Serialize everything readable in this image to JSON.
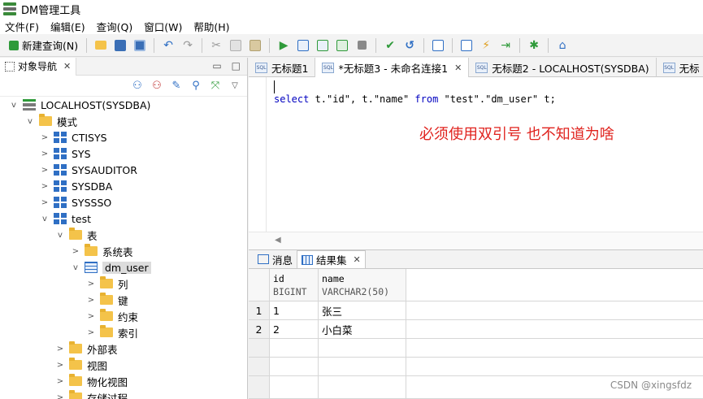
{
  "window": {
    "title": "DM管理工具"
  },
  "menu": [
    "文件(F)",
    "编辑(E)",
    "查询(Q)",
    "窗口(W)",
    "帮助(H)"
  ],
  "toolbar": {
    "new_query_label": "新建查询(N)"
  },
  "navigator": {
    "tab_label": "对象导航",
    "tree": [
      {
        "label": "LOCALHOST(SYSDBA)",
        "icon": "server",
        "twisty": "expanded",
        "level": 0
      },
      {
        "label": "模式",
        "icon": "folder",
        "twisty": "expanded",
        "level": 1
      },
      {
        "label": "CTISYS",
        "icon": "schema",
        "twisty": "collapsed",
        "level": 2
      },
      {
        "label": "SYS",
        "icon": "schema",
        "twisty": "collapsed",
        "level": 2
      },
      {
        "label": "SYSAUDITOR",
        "icon": "schema",
        "twisty": "collapsed",
        "level": 2
      },
      {
        "label": "SYSDBA",
        "icon": "schema",
        "twisty": "collapsed",
        "level": 2
      },
      {
        "label": "SYSSSO",
        "icon": "schema",
        "twisty": "collapsed",
        "level": 2
      },
      {
        "label": "test",
        "icon": "schema",
        "twisty": "expanded",
        "level": 2
      },
      {
        "label": "表",
        "icon": "folder",
        "twisty": "expanded",
        "level": 3
      },
      {
        "label": "系统表",
        "icon": "folder",
        "twisty": "collapsed",
        "level": 4
      },
      {
        "label": "dm_user",
        "icon": "table",
        "twisty": "expanded",
        "level": 4,
        "selected": true
      },
      {
        "label": "列",
        "icon": "folder",
        "twisty": "collapsed",
        "level": 5
      },
      {
        "label": "键",
        "icon": "folder",
        "twisty": "collapsed",
        "level": 5
      },
      {
        "label": "约束",
        "icon": "folder",
        "twisty": "collapsed",
        "level": 5
      },
      {
        "label": "索引",
        "icon": "folder",
        "twisty": "collapsed",
        "level": 5
      },
      {
        "label": "外部表",
        "icon": "folder",
        "twisty": "collapsed",
        "level": 3
      },
      {
        "label": "视图",
        "icon": "folder",
        "twisty": "collapsed",
        "level": 3
      },
      {
        "label": "物化视图",
        "icon": "folder",
        "twisty": "collapsed",
        "level": 3
      },
      {
        "label": "存储过程",
        "icon": "folder",
        "twisty": "collapsed",
        "level": 3
      }
    ]
  },
  "editor_tabs": [
    {
      "label": "无标题1",
      "active": false,
      "closable": false
    },
    {
      "label": "*无标题3 - 未命名连接1",
      "active": true,
      "closable": true
    },
    {
      "label": "无标题2 - LOCALHOST(SYSDBA)",
      "active": false,
      "closable": false
    },
    {
      "label": "无标",
      "active": false,
      "closable": false
    }
  ],
  "editor": {
    "sql_tokens": [
      {
        "t": "select",
        "kw": true
      },
      {
        "t": " t.\"id\", t.\"name\" "
      },
      {
        "t": "from",
        "kw": true
      },
      {
        "t": " \"test\".\"dm_user\" t;"
      }
    ],
    "annotation": "必须使用双引号 也不知道为啥",
    "annotation_color": "#e0231e"
  },
  "result_tabs": [
    {
      "label": "消息",
      "active": false
    },
    {
      "label": "结果集",
      "active": true
    }
  ],
  "result": {
    "columns": [
      {
        "name": "id",
        "type": "BIGINT"
      },
      {
        "name": "name",
        "type": "VARCHAR2(50)"
      }
    ],
    "rows": [
      [
        "1",
        "1",
        "张三"
      ],
      [
        "2",
        "2",
        "小白菜"
      ]
    ]
  },
  "watermark": "CSDN @xingsfdz"
}
